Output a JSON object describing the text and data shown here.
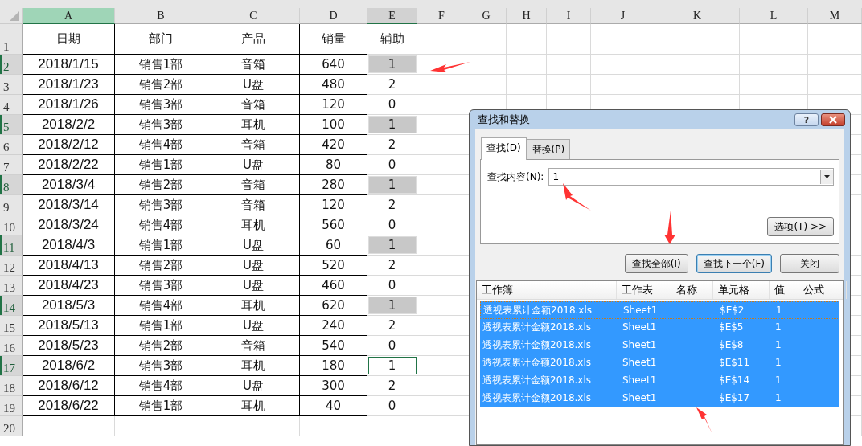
{
  "sheet": {
    "columns": [
      {
        "label": "A",
        "current": true,
        "selected": false
      },
      {
        "label": "B",
        "current": false,
        "selected": false
      },
      {
        "label": "C",
        "current": false,
        "selected": false
      },
      {
        "label": "D",
        "current": false,
        "selected": false
      },
      {
        "label": "E",
        "current": false,
        "selected": true
      },
      {
        "label": "F",
        "current": false,
        "selected": false
      },
      {
        "label": "G",
        "current": false,
        "selected": false
      },
      {
        "label": "H",
        "current": false,
        "selected": false
      },
      {
        "label": "I",
        "current": false,
        "selected": false
      },
      {
        "label": "J",
        "current": false,
        "selected": false
      },
      {
        "label": "K",
        "current": false,
        "selected": false
      },
      {
        "label": "L",
        "current": false,
        "selected": false
      },
      {
        "label": "M",
        "current": false,
        "selected": false
      }
    ],
    "rows": [
      {
        "number": "1",
        "kind": "header",
        "selected": false,
        "cells": [
          "日期",
          "部门",
          "产品",
          "销量",
          "辅助"
        ]
      },
      {
        "number": "2",
        "kind": "data",
        "selected": true,
        "cells": [
          "2018/1/15",
          "销售1部",
          "音箱",
          "640",
          "1"
        ],
        "found": true,
        "active": false
      },
      {
        "number": "3",
        "kind": "data",
        "selected": false,
        "cells": [
          "2018/1/23",
          "销售2部",
          "U盘",
          "480",
          "2"
        ],
        "found": false,
        "active": false
      },
      {
        "number": "4",
        "kind": "data",
        "selected": false,
        "cells": [
          "2018/1/26",
          "销售3部",
          "音箱",
          "120",
          "0"
        ],
        "found": false,
        "active": false
      },
      {
        "number": "5",
        "kind": "data",
        "selected": true,
        "cells": [
          "2018/2/2",
          "销售3部",
          "耳机",
          "100",
          "1"
        ],
        "found": true,
        "active": false
      },
      {
        "number": "6",
        "kind": "data",
        "selected": false,
        "cells": [
          "2018/2/12",
          "销售4部",
          "音箱",
          "420",
          "2"
        ],
        "found": false,
        "active": false
      },
      {
        "number": "7",
        "kind": "data",
        "selected": false,
        "cells": [
          "2018/2/22",
          "销售1部",
          "U盘",
          "80",
          "0"
        ],
        "found": false,
        "active": false
      },
      {
        "number": "8",
        "kind": "data",
        "selected": true,
        "cells": [
          "2018/3/4",
          "销售2部",
          "音箱",
          "280",
          "1"
        ],
        "found": true,
        "active": false
      },
      {
        "number": "9",
        "kind": "data",
        "selected": false,
        "cells": [
          "2018/3/14",
          "销售3部",
          "音箱",
          "120",
          "2"
        ],
        "found": false,
        "active": false
      },
      {
        "number": "10",
        "kind": "data",
        "selected": false,
        "cells": [
          "2018/3/24",
          "销售4部",
          "耳机",
          "560",
          "0"
        ],
        "found": false,
        "active": false
      },
      {
        "number": "11",
        "kind": "data",
        "selected": true,
        "cells": [
          "2018/4/3",
          "销售1部",
          "U盘",
          "60",
          "1"
        ],
        "found": true,
        "active": false
      },
      {
        "number": "12",
        "kind": "data",
        "selected": false,
        "cells": [
          "2018/4/13",
          "销售2部",
          "U盘",
          "520",
          "2"
        ],
        "found": false,
        "active": false
      },
      {
        "number": "13",
        "kind": "data",
        "selected": false,
        "cells": [
          "2018/4/23",
          "销售3部",
          "U盘",
          "460",
          "0"
        ],
        "found": false,
        "active": false
      },
      {
        "number": "14",
        "kind": "data",
        "selected": true,
        "cells": [
          "2018/5/3",
          "销售4部",
          "耳机",
          "620",
          "1"
        ],
        "found": true,
        "active": false
      },
      {
        "number": "15",
        "kind": "data",
        "selected": false,
        "cells": [
          "2018/5/13",
          "销售1部",
          "U盘",
          "240",
          "2"
        ],
        "found": false,
        "active": false
      },
      {
        "number": "16",
        "kind": "data",
        "selected": false,
        "cells": [
          "2018/5/23",
          "销售2部",
          "音箱",
          "540",
          "0"
        ],
        "found": false,
        "active": false
      },
      {
        "number": "17",
        "kind": "data",
        "selected": true,
        "cells": [
          "2018/6/2",
          "销售3部",
          "耳机",
          "180",
          "1"
        ],
        "found": false,
        "active": true
      },
      {
        "number": "18",
        "kind": "data",
        "selected": false,
        "cells": [
          "2018/6/12",
          "销售4部",
          "U盘",
          "300",
          "2"
        ],
        "found": false,
        "active": false
      },
      {
        "number": "19",
        "kind": "data",
        "selected": false,
        "cells": [
          "2018/6/22",
          "销售1部",
          "耳机",
          "40",
          "0"
        ],
        "found": false,
        "active": false
      },
      {
        "number": "20",
        "kind": "empty",
        "selected": false,
        "cells": []
      }
    ]
  },
  "dialog": {
    "title": "查找和替换",
    "help_button": "?",
    "tabs": [
      {
        "label": "查找(D)",
        "selected": true
      },
      {
        "label": "替换(P)",
        "selected": false
      }
    ],
    "find_label": "查找内容(N):",
    "find_value": "1",
    "options_button": "选项(T) >>",
    "buttons": [
      {
        "label": "查找全部(I)",
        "default": false
      },
      {
        "label": "查找下一个(F)",
        "default": true
      },
      {
        "label": "关闭",
        "default": false
      }
    ],
    "results": {
      "columns": [
        "工作簿",
        "工作表",
        "名称",
        "单元格",
        "值",
        "公式"
      ],
      "rows": [
        {
          "cells": [
            "透视表累计金额2018.xls",
            "Sheet1",
            "",
            "$E$2",
            "1",
            ""
          ],
          "selected": true,
          "focused": true
        },
        {
          "cells": [
            "透视表累计金额2018.xls",
            "Sheet1",
            "",
            "$E$5",
            "1",
            ""
          ],
          "selected": true,
          "focused": false
        },
        {
          "cells": [
            "透视表累计金额2018.xls",
            "Sheet1",
            "",
            "$E$8",
            "1",
            ""
          ],
          "selected": true,
          "focused": false
        },
        {
          "cells": [
            "透视表累计金额2018.xls",
            "Sheet1",
            "",
            "$E$11",
            "1",
            ""
          ],
          "selected": true,
          "focused": false
        },
        {
          "cells": [
            "透视表累计金额2018.xls",
            "Sheet1",
            "",
            "$E$14",
            "1",
            ""
          ],
          "selected": true,
          "focused": false
        },
        {
          "cells": [
            "透视表累计金额2018.xls",
            "Sheet1",
            "",
            "$E$17",
            "1",
            ""
          ],
          "selected": true,
          "focused": false
        }
      ]
    }
  }
}
